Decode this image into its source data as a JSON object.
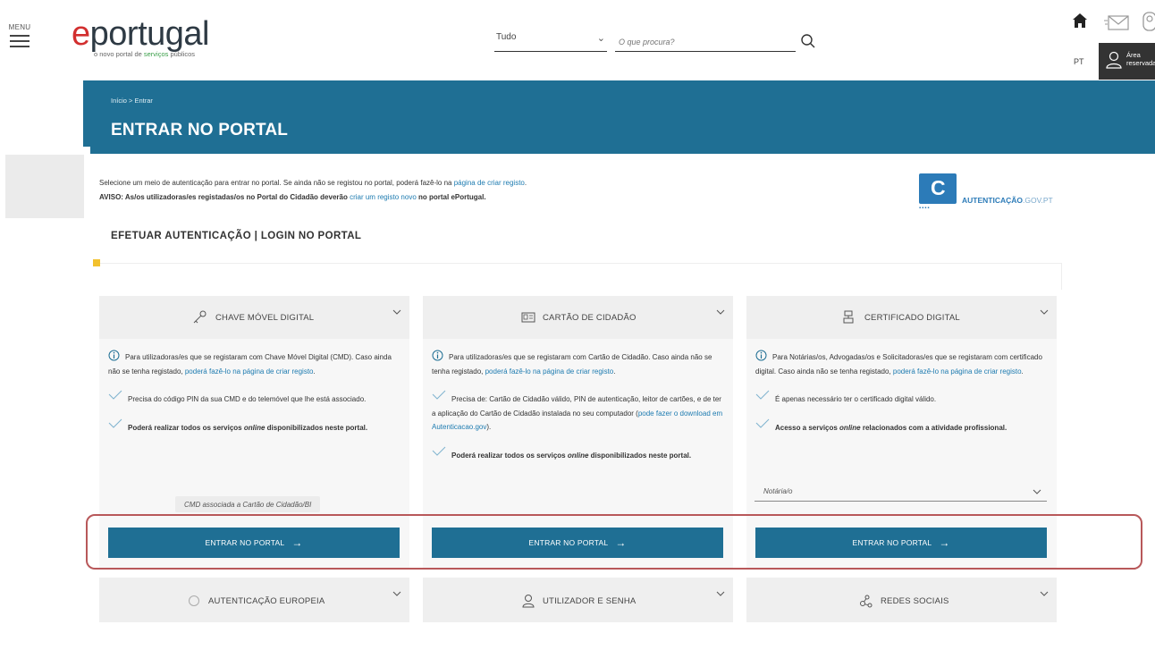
{
  "header": {
    "menu_label": "MENU",
    "logo": {
      "e": "e",
      "word": "portugal",
      "tagline_start": "o novo portal de ",
      "tagline_green": "serviços",
      "tagline_end": " públicos"
    },
    "search_scope": "Tudo",
    "search_placeholder": "O que procura?",
    "language": "PT",
    "area_reserved": "Área reservada"
  },
  "band": {
    "breadcrumb": "Início  >  Entrar",
    "title": "ENTRAR NO PORTAL"
  },
  "intro": {
    "line1_text": "Selecione um meio de autenticação para entrar no portal. Se ainda não se registou no portal, poderá fazê-lo na ",
    "line1_link": "página de criar registo",
    "line1_end": ".",
    "line2_start": "AVISO: As/os utilizadoras/es registadas/os no Portal do Cidadão deverão ",
    "line2_link": "criar um registo novo",
    "line2_end": " no portal ePortugal."
  },
  "autenticacao_logo": {
    "bold": "AUTENTICAÇÃO",
    "light": ".GOV.PT"
  },
  "section_title": "EFETUAR AUTENTICAÇÃO | LOGIN NO PORTAL",
  "cards": [
    {
      "title": "CHAVE MÓVEL DIGITAL",
      "info_text": "Para utilizadoras/es que se registaram com Chave Móvel Digital (CMD). Caso ainda não se tenha registado, ",
      "info_link": "poderá fazê-lo na página de criar registo",
      "info_end": ".",
      "check1": "Precisa do código PIN da sua CMD e do telemóvel que lhe está associado.",
      "check2_start": "Poderá realizar todos os serviços ",
      "check2_italic": "online",
      "check2_end": " disponibilizados neste portal.",
      "tag": "CMD associada a Cartão de Cidadão/BI",
      "button": "ENTRAR NO PORTAL"
    },
    {
      "title": "CARTÃO DE CIDADÃO",
      "info_text": "Para utilizadoras/es que se registaram com Cartão de Cidadão. Caso ainda não se tenha registado, ",
      "info_link": "poderá fazê-lo na página de criar registo",
      "info_end": ".",
      "check1_start": "Precisa de: Cartão de Cidadão válido, PIN de autenticação, leitor de cartões, e de ter a aplicação do Cartão de Cidadão instalada no seu computador (",
      "check1_link": "pode fazer o download em Autenticacao.gov",
      "check1_end": ").",
      "check2_start": "Poderá realizar todos os serviços ",
      "check2_italic": "online",
      "check2_end": " disponibilizados neste portal.",
      "button": "ENTRAR NO PORTAL"
    },
    {
      "title": "CERTIFICADO DIGITAL",
      "info_text": "Para Notárias/os, Advogadas/os e Solicitadoras/es que se registaram com certificado digital. Caso ainda não se tenha registado, ",
      "info_link": "poderá fazê-lo na página de criar registo",
      "info_end": ".",
      "check1": "É apenas necessário ter o certificado digital válido.",
      "check2_start": "Acesso a serviços ",
      "check2_italic": "online",
      "check2_end": " relacionados com a atividade profissional.",
      "select_value": "Notária/o",
      "button": "ENTRAR NO PORTAL"
    }
  ],
  "more_methods": [
    {
      "title": "AUTENTICAÇÃO EUROPEIA"
    },
    {
      "title": "UTILIZADOR E SENHA"
    },
    {
      "title": "REDES SOCIAIS"
    }
  ],
  "colors": {
    "primary": "#1f6f94",
    "link": "#1d7bb0",
    "highlight_border": "#b8585a",
    "accent_yellow": "#f2c12e"
  }
}
